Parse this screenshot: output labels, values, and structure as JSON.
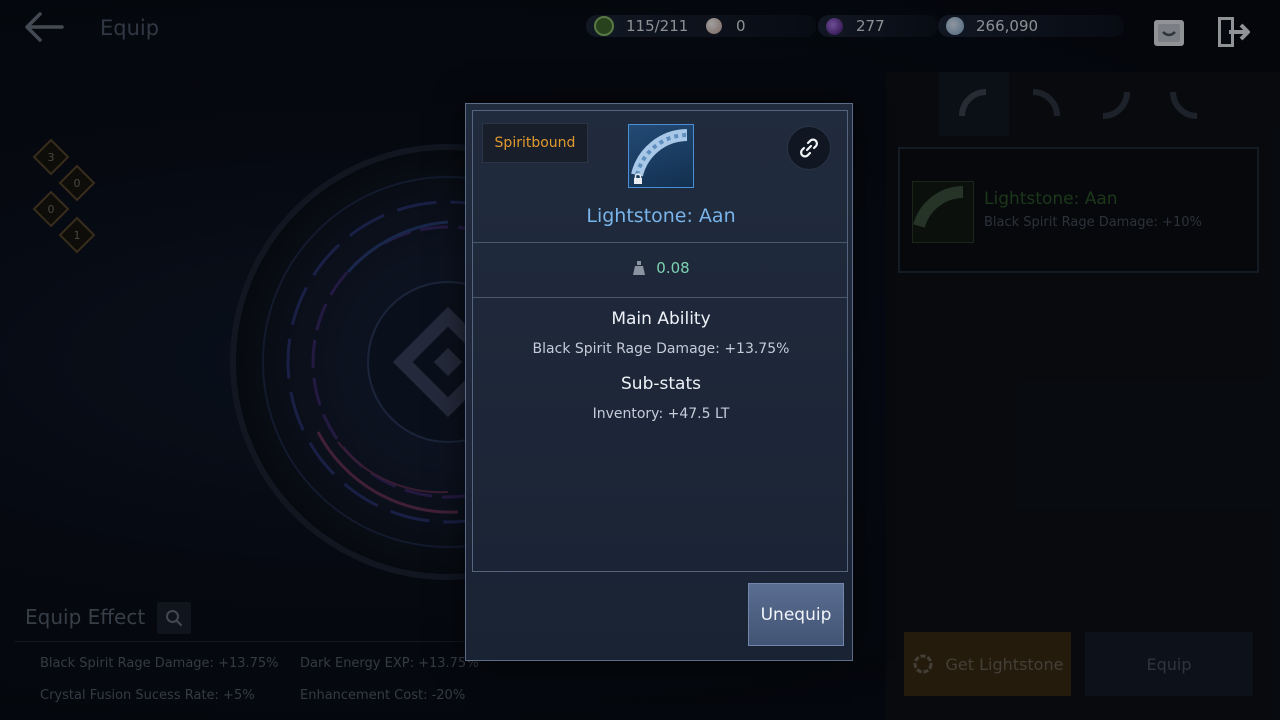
{
  "header": {
    "title": "Equip",
    "resources": [
      {
        "icon": "energy-icon",
        "value": "115/211",
        "color": "#6aa84f"
      },
      {
        "icon": "pearl-icon",
        "value": "0",
        "color": "#e8cfc8"
      },
      {
        "icon": "black-gem-icon",
        "value": "277",
        "color": "#7b3fc4"
      },
      {
        "icon": "silver-coin-icon",
        "value": "266,090",
        "color": "#9ec3e6"
      }
    ]
  },
  "equip_effect": {
    "title": "Equip Effect",
    "effects": [
      "Black Spirit Rage Damage: +13.75%",
      "Dark Energy EXP: +13.75%",
      "Crystal Fusion Sucess Rate: +5%",
      "Enhancement Cost: -20%"
    ]
  },
  "set_counts": [
    "3",
    "0",
    "0",
    "1"
  ],
  "modal": {
    "badge": "Spiritbound",
    "item_name": "Lightstone: Aan",
    "weight": "0.08",
    "main_ability_title": "Main Ability",
    "main_ability": "Black Spirit Rage Damage: +13.75%",
    "substats_title": "Sub-stats",
    "substats": [
      "Inventory: +47.5 LT"
    ],
    "unequip_label": "Unequip"
  },
  "side_panel": {
    "owned_item": {
      "name": "Lightstone: Aan",
      "stat": "Black Spirit Rage Damage: +10%"
    },
    "get_label": "Get Lightstone",
    "equip_label": "Equip"
  },
  "colors": {
    "item_name": "#79b4ea",
    "badge": "#e09a2c",
    "weight": "#7ed1b2"
  }
}
